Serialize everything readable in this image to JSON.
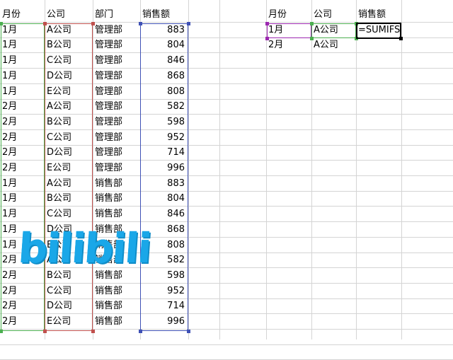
{
  "left_table": {
    "headers": [
      "月份",
      "公司",
      "部门",
      "销售额"
    ],
    "rows": [
      [
        "1月",
        "A公司",
        "管理部",
        "883"
      ],
      [
        "1月",
        "B公司",
        "管理部",
        "804"
      ],
      [
        "1月",
        "C公司",
        "管理部",
        "846"
      ],
      [
        "1月",
        "D公司",
        "管理部",
        "868"
      ],
      [
        "1月",
        "E公司",
        "管理部",
        "808"
      ],
      [
        "2月",
        "A公司",
        "管理部",
        "582"
      ],
      [
        "2月",
        "B公司",
        "管理部",
        "598"
      ],
      [
        "2月",
        "C公司",
        "管理部",
        "952"
      ],
      [
        "2月",
        "D公司",
        "管理部",
        "714"
      ],
      [
        "2月",
        "E公司",
        "管理部",
        "996"
      ],
      [
        "1月",
        "A公司",
        "销售部",
        "883"
      ],
      [
        "1月",
        "B公司",
        "销售部",
        "804"
      ],
      [
        "1月",
        "C公司",
        "销售部",
        "846"
      ],
      [
        "1月",
        "D公司",
        "销售部",
        "868"
      ],
      [
        "1月",
        "E公司",
        "销售部",
        "808"
      ],
      [
        "2月",
        "A公司",
        "销售部",
        "582"
      ],
      [
        "2月",
        "B公司",
        "销售部",
        "598"
      ],
      [
        "2月",
        "C公司",
        "销售部",
        "952"
      ],
      [
        "2月",
        "D公司",
        "销售部",
        "714"
      ],
      [
        "2月",
        "E公司",
        "销售部",
        "996"
      ]
    ]
  },
  "right_table": {
    "headers": [
      "月份",
      "公司",
      "销售额"
    ],
    "rows": [
      [
        "1月",
        "A公司",
        "=SUMIFS(D"
      ],
      [
        "2月",
        "A公司",
        ""
      ]
    ]
  },
  "watermark": "bilibili",
  "colors": {
    "grid": "#d4d4d4",
    "ref_green": "#4caf50",
    "ref_red": "#c0504d",
    "ref_blue": "#3f51b5",
    "ref_purple": "#9c27b0",
    "active_cell": "#000000",
    "watermark": "#1aa7e8"
  }
}
